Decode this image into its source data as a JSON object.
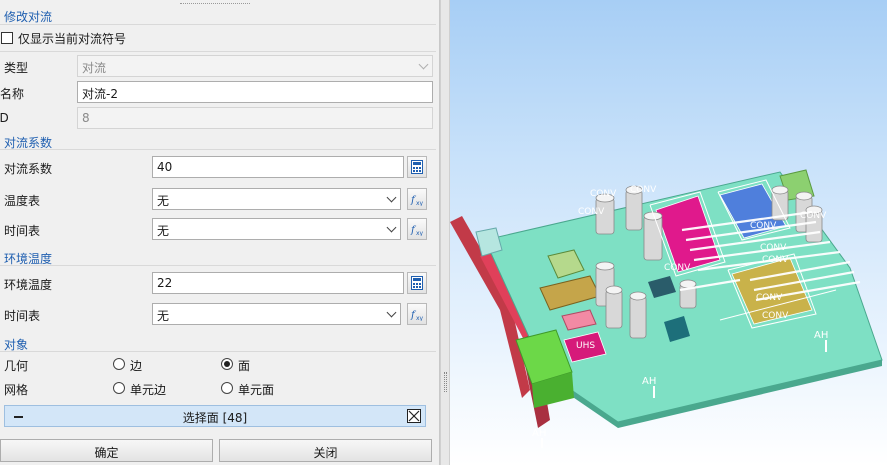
{
  "panel": {
    "modify_title": "修改对流",
    "only_show_label": "仅显示当前对流符号",
    "type_label": "类型",
    "type_value": "对流",
    "name_label": "名称",
    "name_value": "对流-2",
    "id_label": "ID",
    "id_value": "8",
    "coef_section": "对流系数",
    "coef_label": "对流系数",
    "coef_value": "40",
    "temp_table_label": "温度表",
    "temp_table_value": "无",
    "time_table_label": "时间表",
    "time_table_value": "无",
    "env_section": "环境温度",
    "env_temp_label": "环境温度",
    "env_temp_value": "22",
    "env_time_label": "时间表",
    "env_time_value": "无",
    "object_section": "对象",
    "geometry_label": "几何",
    "geo_opt_edge": "边",
    "geo_opt_face": "面",
    "mesh_label": "网格",
    "mesh_opt_edge": "单元边",
    "mesh_opt_face": "单元面",
    "selection_text": "选择面 [48]",
    "ok_label": "确定",
    "close_label": "关闭"
  },
  "icons": {
    "calculator": "calculator-icon",
    "function": "function-icon"
  },
  "viewport": {
    "conv_label": "CONV",
    "ah_label": "AH",
    "uhs_label": "UHS"
  },
  "colors": {
    "accent_blue": "#1f5fb0",
    "board_green": "#7ee0c4",
    "chip_magenta": "#e0198c",
    "chip_blue": "#4f7fdc",
    "chip_gold": "#c9b24a",
    "bracket_red": "#d93a4e",
    "connector_green": "#6cd848"
  }
}
